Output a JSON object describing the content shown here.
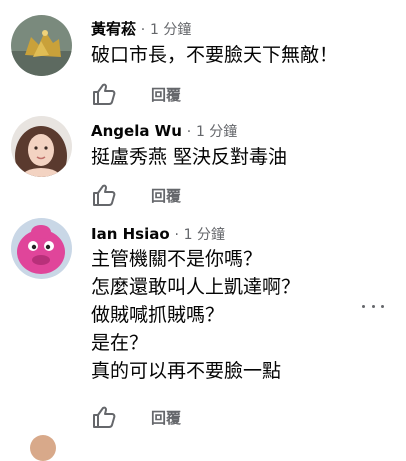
{
  "comments": [
    {
      "author": "黃宥菘",
      "separator": "·",
      "time": "1 分鐘",
      "lines": [
        "破口市長，不要臉天下無敵！"
      ],
      "reply_label": "回覆"
    },
    {
      "author": "Angela Wu",
      "separator": "·",
      "time": "1 分鐘",
      "lines": [
        "挺盧秀燕 堅決反對毒油"
      ],
      "reply_label": "回覆"
    },
    {
      "author": "Ian Hsiao",
      "separator": "·",
      "time": "1 分鐘",
      "lines": [
        "主管機關不是你嗎？",
        "怎麼還敢叫人上凱達啊？",
        "做賊喊抓賊嗎？",
        "是在？",
        "真的可以再不要臉一點"
      ],
      "reply_label": "回覆"
    }
  ]
}
